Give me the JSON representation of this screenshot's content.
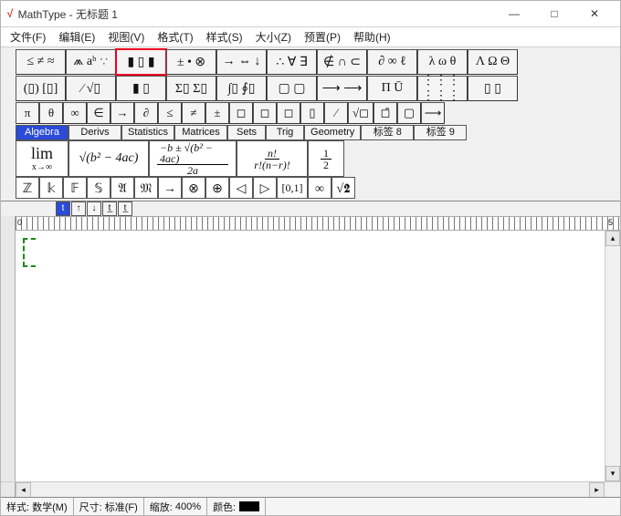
{
  "title": "MathType - 无标题 1",
  "win_controls": {
    "min": "—",
    "max": "□",
    "close": "✕"
  },
  "menu": [
    "文件(F)",
    "编辑(E)",
    "视图(V)",
    "格式(T)",
    "样式(S)",
    "大小(Z)",
    "预置(P)",
    "帮助(H)"
  ],
  "row1": [
    "≤ ≠ ≈",
    "⩕ aᵇ ∵",
    "▮ ▯ ▮",
    "± • ⊗",
    "→ ⇔ ↓",
    "∴ ∀ ∃",
    "∉ ∩ ⊂",
    "∂ ∞ ℓ",
    "λ ω θ",
    "Λ Ω Θ"
  ],
  "row1_highlight_index": 2,
  "row2": [
    "(▯) [▯]",
    "⁄ √▯",
    "▮ ▯",
    "Σ▯ Σ▯",
    "∫▯ ∮▯",
    "▢ ▢",
    "⟶  ⟶",
    "Π Ū",
    "⋮⋮⋮ ⋮⋮⋮",
    "▯ ▯"
  ],
  "row3": [
    "π",
    "θ",
    "∞",
    "∈",
    "→",
    "∂",
    "≤",
    "≠",
    "±",
    "◻",
    "◻",
    "◻",
    "▯",
    "⁄",
    "√◻",
    "◻̄",
    "▢",
    "⟶"
  ],
  "tabs": [
    "Algebra",
    "Derivs",
    "Statistics",
    "Matrices",
    "Sets",
    "Trig",
    "Geometry",
    "标签 8",
    "标签 9"
  ],
  "active_tab": 0,
  "bigcells": {
    "lim_top": "lim",
    "lim_bot": "x→∞",
    "sqrt": "√(b² − 4ac)",
    "quad_num": "−b ± √(b² − 4ac)",
    "quad_den": "2a",
    "perm_num": "n!",
    "perm_den": "r!(n−r)!",
    "half_num": "1",
    "half_den": "2"
  },
  "symrow": [
    "ℤ",
    "𝕜",
    "𝔽",
    "𝕊",
    "𝔄",
    "𝔐",
    "→",
    "⊗",
    "⊕",
    "◁",
    "▷",
    "[0,1]",
    "∞",
    "√2"
  ],
  "ministrip": [
    "t",
    "↑",
    "↓",
    "t̲",
    "t̲"
  ],
  "ruler": {
    "left": "0",
    "right": "5"
  },
  "status": {
    "style_label": "样式:",
    "style_val": "数学(M)",
    "size_label": "尺寸:",
    "size_val": "标准(F)",
    "zoom_label": "缩放:",
    "zoom_val": "400%",
    "color_label": "颜色:"
  }
}
